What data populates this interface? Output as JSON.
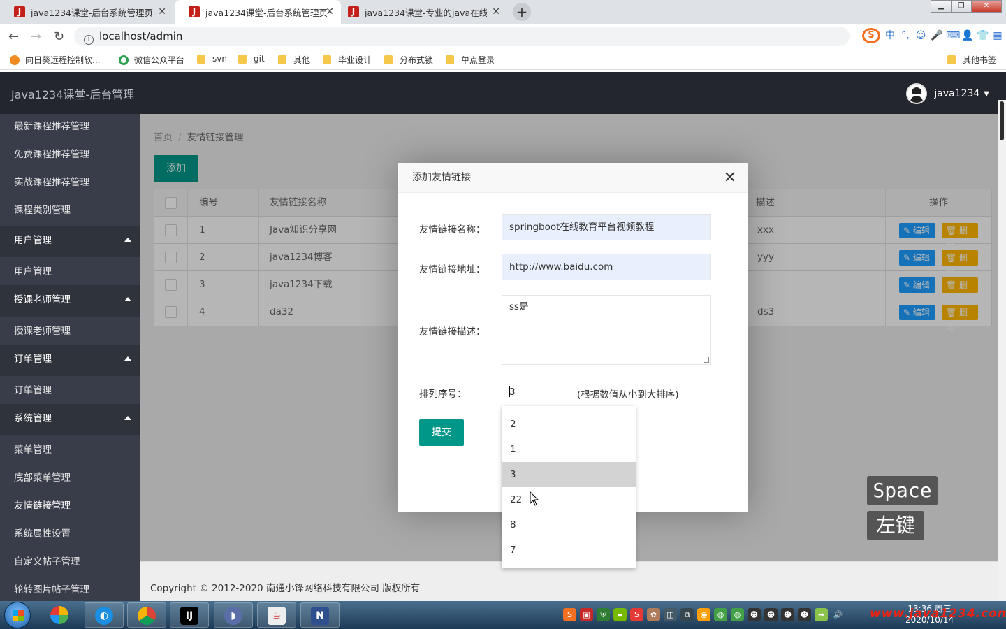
{
  "browser": {
    "tabs": [
      {
        "title": "java1234课堂-后台系统管理页面"
      },
      {
        "title": "java1234课堂-后台系统管理页面"
      },
      {
        "title": "java1234课堂-专业的java在线教育平台"
      }
    ],
    "url": "localhost/admin",
    "bookmarks": [
      "向日葵远程控制软...",
      "微信公众平台",
      "svn",
      "git",
      "其他",
      "毕业设计",
      "分布式锁",
      "单点登录"
    ],
    "other_bookmarks": "其他书签"
  },
  "app": {
    "brand": "Java1234课堂-后台管理",
    "username": "java1234"
  },
  "sidebar": {
    "items": [
      {
        "label": "最新课程推荐管理"
      },
      {
        "label": "免费课程推荐管理"
      },
      {
        "label": "实战课程推荐管理"
      },
      {
        "label": "课程类别管理"
      },
      {
        "label": "用户管理"
      },
      {
        "label": "用户管理"
      },
      {
        "label": "授课老师管理"
      },
      {
        "label": "授课老师管理"
      },
      {
        "label": "订单管理"
      },
      {
        "label": "订单管理"
      },
      {
        "label": "系统管理"
      },
      {
        "label": "菜单管理"
      },
      {
        "label": "底部菜单管理"
      },
      {
        "label": "友情链接管理"
      },
      {
        "label": "系统属性设置"
      },
      {
        "label": "自定义帖子管理"
      },
      {
        "label": "轮转图片帖子管理"
      }
    ]
  },
  "breadcrumb": {
    "home": "首页",
    "sep": "/",
    "current": "友情链接管理"
  },
  "toolbar": {
    "add_label": "添加"
  },
  "table": {
    "headers": {
      "id": "编号",
      "name": "友情链接名称",
      "desc": "描述",
      "ops": "操作"
    },
    "edit_label": "✎ 编辑",
    "delete_label": "🗑 删除",
    "rows": [
      {
        "id": "1",
        "name": "Java知识分享网",
        "desc": "xxx"
      },
      {
        "id": "2",
        "name": "java1234博客",
        "desc": "yyy"
      },
      {
        "id": "3",
        "name": "java1234下载",
        "desc": ""
      },
      {
        "id": "4",
        "name": "da32",
        "desc": "ds3"
      }
    ]
  },
  "footer": {
    "copyright": "Copyright © 2012-2020 南通小锋网络科技有限公司 版权所有"
  },
  "modal": {
    "title": "添加友情链接",
    "close": "✕",
    "name_label": "友情链接名称：",
    "name_value": "springboot在线教育平台视频教程",
    "url_label": "友情链接地址：",
    "url_value": "http://www.baidu.com",
    "desc_label": "友情链接描述：",
    "desc_value": "ss是",
    "sort_label": "排列序号：",
    "sort_value": "3",
    "sort_hint": "(根据数值从小到大排序)",
    "submit_label": "提交"
  },
  "autocomplete": {
    "options": [
      "2",
      "1",
      "3",
      "22",
      "8",
      "7"
    ],
    "highlighted": "3"
  },
  "key_hints": {
    "key1": "Space",
    "key2": "左键"
  },
  "watermark": "www.java1234.com",
  "taskbar": {
    "time": "13:36 周三",
    "date": "2020/10/14"
  }
}
